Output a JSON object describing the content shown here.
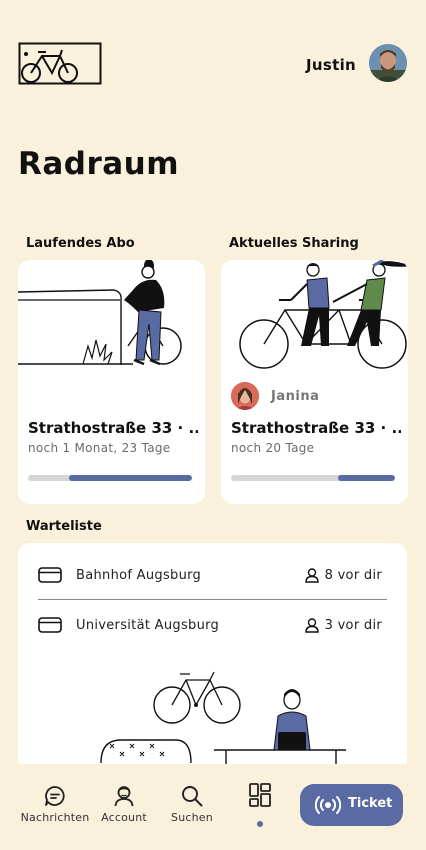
{
  "header": {
    "user_name": "Justin",
    "logo_icon": "bike-room-logo-icon",
    "avatar_icon": "user-avatar"
  },
  "page": {
    "title": "Radraum"
  },
  "subscription": {
    "section_title": "Laufendes Abo",
    "title": "Strathostraße 33 · ...",
    "subtitle": "noch 1 Monat, 23 Tage",
    "remaining_fraction": 0.75
  },
  "sharing": {
    "section_title": "Aktuelles Sharing",
    "partner_name": "Janina",
    "title": "Strathostraße 33 · ...",
    "subtitle": "noch 20 Tage",
    "remaining_fraction": 0.35
  },
  "waitlist": {
    "section_title": "Warteliste",
    "items": [
      {
        "location": "Bahnhof Augsburg",
        "position": "8 vor dir"
      },
      {
        "location": "Universität Augsburg",
        "position": "3 vor dir"
      }
    ]
  },
  "tabbar": {
    "tabs": [
      {
        "label": "Nachrichten",
        "icon": "chat-icon"
      },
      {
        "label": "Account",
        "icon": "account-icon"
      },
      {
        "label": "Suchen",
        "icon": "search-icon"
      },
      {
        "label": "",
        "icon": "dashboard-icon",
        "active": true
      }
    ],
    "ticket_label": "Ticket",
    "ticket_icon": "broadcast-icon"
  },
  "colors": {
    "background": "#faf1dc",
    "accent": "#5a6aa3",
    "card": "#ffffff"
  }
}
